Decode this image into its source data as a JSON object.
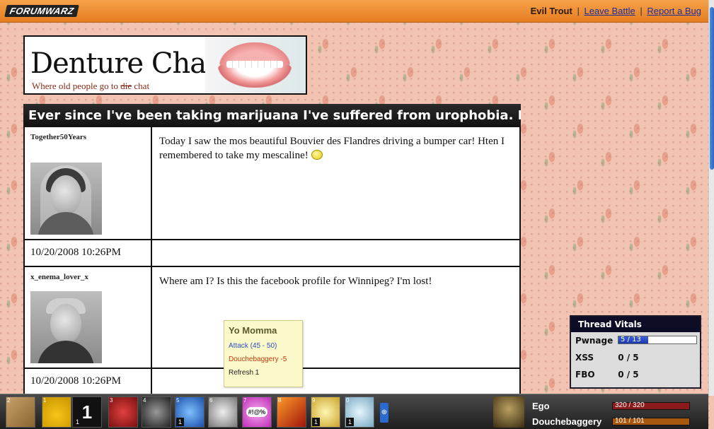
{
  "topbar": {
    "logo": "FORUMWARZ",
    "username": "Evil Trout",
    "separator": "|",
    "links": [
      "Leave Battle",
      "Report a Bug"
    ]
  },
  "banner": {
    "title": "Denture Chat",
    "tagline_before": "Where old people go to",
    "tagline_struck": "die",
    "tagline_after": "chat"
  },
  "thread": {
    "title": "Ever since I've been taking marijuana I've suffered from urophobia. Help!",
    "posts": [
      {
        "author": "Together50Years",
        "content": "Today I saw the mos beautiful Bouvier des Flandres driving a bumper car! Hten I remembered to take my mescaline!",
        "date": "10/20/2008 10:26PM"
      },
      {
        "author": "x_enema_lover_x",
        "content": "Where am I? Is this the facebook profile for Winnipeg? I'm lost!",
        "date": "10/20/2008 10:26PM"
      }
    ]
  },
  "popup": {
    "title": "Yo Momma",
    "attack": "Attack (45 - 50)",
    "douchebaggery": "Douchebaggery -5",
    "refresh": "Refresh 1"
  },
  "vitals": {
    "header": "Thread Vitals",
    "pwnage": {
      "label": "Pwnage",
      "value": "5 / 13",
      "fraction": 0.385
    },
    "xss": {
      "label": "XSS",
      "value": "0 / 5"
    },
    "fbo": {
      "label": "FBO",
      "value": "0 / 5"
    }
  },
  "toolbar": {
    "slots": [
      {
        "num": "2",
        "count": "",
        "icon": "cardboard-box-icon"
      },
      {
        "num": "1",
        "count": "",
        "icon": "hard-hat-icon"
      },
      {
        "num": "",
        "count": "1",
        "icon": "number-one-icon"
      },
      {
        "num": "3",
        "count": "",
        "icon": "red-splatter-icon"
      },
      {
        "num": "4",
        "count": "",
        "icon": "hand-gesture-icon"
      },
      {
        "num": "5",
        "count": "1",
        "icon": "blue-swirl-icon"
      },
      {
        "num": "6",
        "count": "",
        "icon": "woman-portrait-icon"
      },
      {
        "num": "7",
        "count": "",
        "icon": "speech-bubble-icon",
        "text": "#!@%"
      },
      {
        "num": "8",
        "count": "",
        "icon": "flame-icon"
      },
      {
        "num": "9",
        "count": "1",
        "icon": "gold-item-icon"
      },
      {
        "num": "0",
        "count": "1",
        "icon": "crystal-icon"
      }
    ],
    "more_symbol": "⊕"
  },
  "stats": {
    "ego": {
      "label": "Ego",
      "value": "320 / 320",
      "fraction": 1.0,
      "color": "#8b1a1a"
    },
    "douchebaggery": {
      "label": "Douchebaggery",
      "value": "101 / 101",
      "fraction": 1.0,
      "color": "#a8570e"
    }
  },
  "colors": {
    "topbar": "#f08a2e",
    "link": "#1a2f9c",
    "thread_header": "#111111",
    "vitals_header": "#0c0c26"
  }
}
